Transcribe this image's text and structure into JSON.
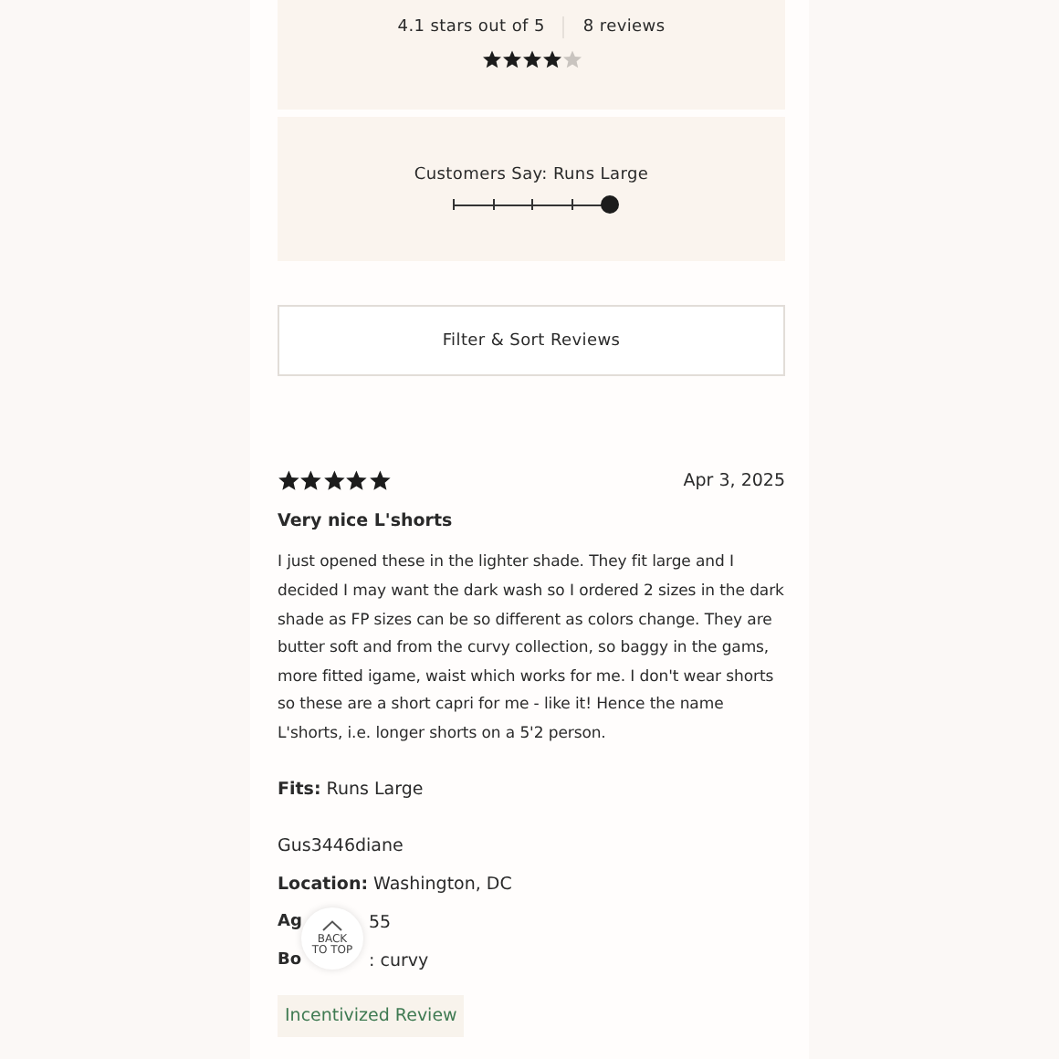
{
  "summary": {
    "rating_text": "4.1 stars out of 5",
    "review_count": "8 reviews",
    "stars": 4
  },
  "fit": {
    "label": "Customers Say: Runs Large",
    "level": 1
  },
  "filter_button": "Filter & Sort Reviews",
  "review": {
    "stars": 5,
    "date": "Apr 3, 2025",
    "title": "Very nice L'shorts",
    "body": "I just opened these in the lighter shade. They fit large and I decided I may want the dark wash so I ordered 2 sizes in the dark shade as FP sizes can be so different as colors change. They are butter soft and from the curvy collection, so baggy in the gams, more fitted igame, waist which works for me. I don't wear shorts so these are a short capri for me - like it! Hence the name L'shorts, i.e. longer shorts on a 5'2 person.",
    "fits": {
      "label": "Fits:",
      "value": "Runs Large"
    },
    "author": "Gus3446diane",
    "location": {
      "label": "Location:",
      "value": "Washington, DC"
    },
    "details": [
      {
        "label": "Ag",
        "value": "55"
      },
      {
        "label": "Bo",
        "value": ": curvy"
      }
    ],
    "badge": "Incentivized Review"
  },
  "back_to_top": [
    "BACK",
    "TO TOP"
  ]
}
